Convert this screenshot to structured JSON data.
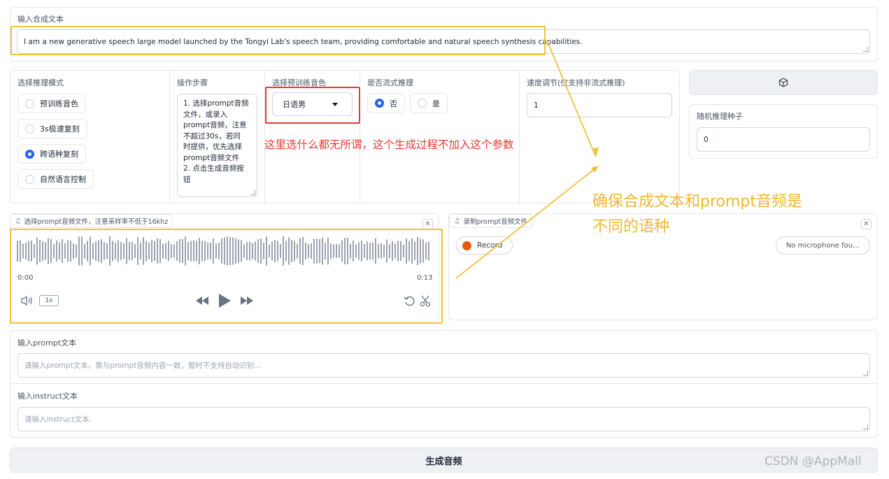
{
  "synth_text": {
    "label": "输入合成文本",
    "value": "I am a new generative speech large model launched by the Tongyi Lab's speech team, providing comfortable and natural speech synthesis capabilities."
  },
  "mode": {
    "label": "选择推理模式",
    "options": [
      "预训练音色",
      "3s极速复刻",
      "跨语种复刻",
      "自然语言控制"
    ],
    "selected": "跨语种复刻"
  },
  "steps": {
    "label": "操作步骤",
    "lines": [
      "1. 选择prompt音频",
      "文件，或录入",
      "prompt音频，注意",
      "不超过30s，若同",
      "时提供，优先选择",
      "prompt音频文件",
      "2. 点击生成音频按",
      "钮"
    ]
  },
  "voice": {
    "label": "选择预训练音色",
    "value": "日语男"
  },
  "stream": {
    "label": "是否流式推理",
    "options": [
      "否",
      "是"
    ],
    "selected": "否"
  },
  "speed": {
    "label": "速度调节(仅支持非流式推理)",
    "value": "1"
  },
  "seed": {
    "label": "随机推理种子",
    "value": "0",
    "dice_icon": "dice-icon"
  },
  "prompt_file": {
    "label": "选择prompt音频文件，注意采样率不低于16khz",
    "time_start": "0:00",
    "time_end": "0:13",
    "speed": "1x"
  },
  "record": {
    "label": "录制prompt音频文件",
    "record_button": "Record",
    "mic_status": "No microphone fou…"
  },
  "prompt_text": {
    "label": "输入prompt文本",
    "placeholder": "请输入prompt文本，需与prompt音频内容一致，暂时不支持自动识别..."
  },
  "instruct_text": {
    "label": "输入instruct文本",
    "placeholder": "请输入instruct文本."
  },
  "generate_button": "生成音频",
  "annotations": {
    "red_note": "这里选什么都无所谓，这个生成过程不加入这个参数",
    "yellow_note_1": "确保合成文本和prompt音频是",
    "yellow_note_2": "不同的语种"
  },
  "watermark": "CSDN @AppMall",
  "colors": {
    "accent_blue": "#2563eb",
    "annotation_red": "#e53935",
    "annotation_yellow": "#f0c23b",
    "record_orange": "#e8590c"
  }
}
